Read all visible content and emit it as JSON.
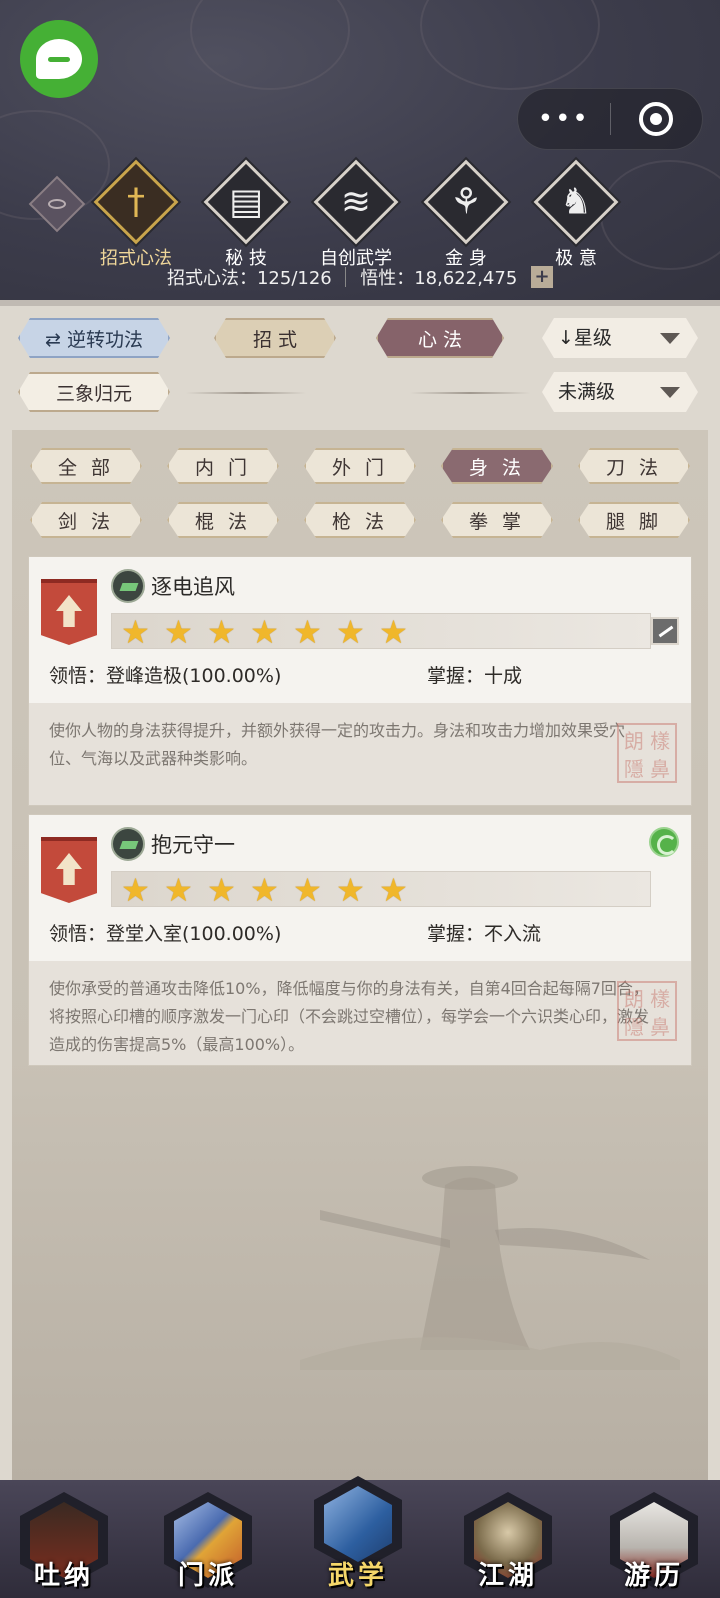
{
  "header": {
    "tabs": [
      {
        "label": "招式心法",
        "icon": "sword-icon",
        "active": true
      },
      {
        "label": "秘 技",
        "icon": "book-icon",
        "active": false
      },
      {
        "label": "自创武学",
        "icon": "scroll-icon",
        "active": false
      },
      {
        "label": "金 身",
        "icon": "meditation-icon",
        "active": false
      },
      {
        "label": "极 意",
        "icon": "martial-pose-icon",
        "active": false
      }
    ],
    "stats": {
      "progress_label": "招式心法：125/126",
      "insight_label": "悟性：18,622,475",
      "plus": "+"
    },
    "capsule_more": "•••"
  },
  "panel": {
    "reverse_button": "逆转功法",
    "tab_moves": "招 式",
    "tab_mind": "心 法",
    "sort_dropdown": "星级",
    "sanxiang_button": "三象归元",
    "filter_dropdown": "未满级"
  },
  "categories": [
    "全 部",
    "内 门",
    "外 门",
    "身 法",
    "刀 法",
    "剑 法",
    "棍 法",
    "枪 法",
    "拳 掌",
    "腿 脚"
  ],
  "active_category": "身 法",
  "cards": [
    {
      "name": "逐电追风",
      "stars": 7,
      "comprehension": "领悟：登峰造极(100.00%)",
      "mastery": "掌握：十成",
      "description": "使你人物的身法获得提升，并额外获得一定的攻击力。身法和攻击力增加效果受穴位、气海以及武器种类影响。",
      "seal": "朗 樣 隱 鼻"
    },
    {
      "name": "抱元守一",
      "stars": 7,
      "comprehension": "领悟：登堂入室(100.00%)",
      "mastery": "掌握：不入流",
      "description": "使你承受的普通攻击降低10%，降低幅度与你的身法有关，自第4回合起每隔7回合，将按照心印槽的顺序激发一门心印（不会跳过空槽位），每学会一个六识类心印，激发造成的伤害提高5%（最高100%）。",
      "seal": "朗 樣 隱 鼻"
    }
  ],
  "nav": [
    {
      "label": "吐纳",
      "icon": "monk-icon",
      "active": false,
      "color": "#7a2d1e"
    },
    {
      "label": "门派",
      "icon": "sect-flags-icon",
      "active": false,
      "color": "#4a6bb0"
    },
    {
      "label": "武学",
      "icon": "manual-books-icon",
      "active": true,
      "color": "#2d5fa0"
    },
    {
      "label": "江湖",
      "icon": "straw-hat-icon",
      "active": false,
      "color": "#7a6a4a"
    },
    {
      "label": "游历",
      "icon": "white-horse-icon",
      "active": false,
      "color": "#8a8a8a"
    }
  ]
}
